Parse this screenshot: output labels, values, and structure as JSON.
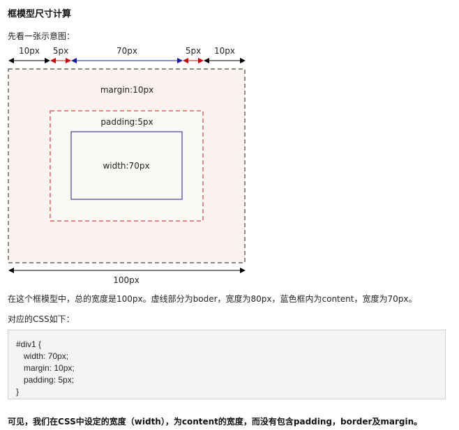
{
  "heading": "框模型尺寸计算",
  "intro": "先看一张示意图：",
  "diagram": {
    "top_labels": [
      "10px",
      "5px",
      "70px",
      "5px",
      "10px"
    ],
    "margin_label": "margin:10px",
    "padding_label": "padding:5px",
    "width_label": "width:70px",
    "bottom_label": "100px",
    "colors": {
      "margin_border": "#666666",
      "margin_fill": "#fcf3f0",
      "padding_border": "#e06060",
      "content_border": "#1a1a8c",
      "arrow_black": "#000000",
      "arrow_red": "#d40000",
      "arrow_blue": "#1a1aa8"
    }
  },
  "paragraph1": "在这个框模型中，总的宽度是100px。虚线部分为boder，宽度为80px，蓝色框内为content，宽度为70px。",
  "paragraph2": "对应的CSS如下：",
  "code": {
    "line1": "#div1 {",
    "line2": "width: 70px;",
    "line3": "margin: 10px;",
    "line4": "padding: 5px;",
    "line5": "}"
  },
  "conclusion": "可见，我们在CSS中设定的宽度（width），为content的宽度，而没有包含padding，border及margin。"
}
